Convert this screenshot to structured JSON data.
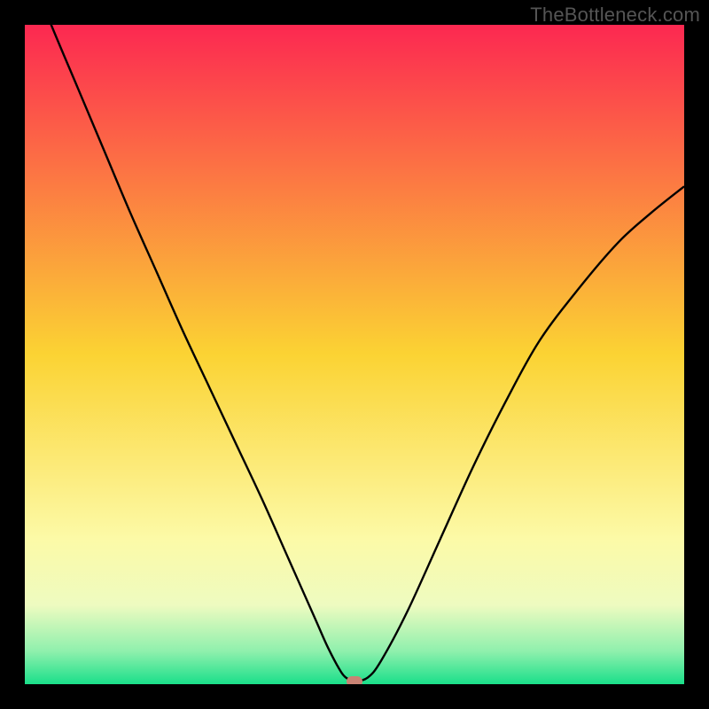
{
  "watermark": "TheBottleneck.com",
  "chart_data": {
    "type": "line",
    "title": "",
    "xlabel": "",
    "ylabel": "",
    "xlim": [
      0,
      100
    ],
    "ylim": [
      0,
      100
    ],
    "grid": false,
    "legend": false,
    "background_gradient": {
      "stops": [
        {
          "pos": 0.0,
          "color": "#fc2851"
        },
        {
          "pos": 0.5,
          "color": "#fbd333"
        },
        {
          "pos": 0.78,
          "color": "#fcfaa7"
        },
        {
          "pos": 0.88,
          "color": "#eefbc0"
        },
        {
          "pos": 0.95,
          "color": "#8ff0ad"
        },
        {
          "pos": 1.0,
          "color": "#1adf8a"
        }
      ]
    },
    "series": [
      {
        "name": "bottleneck-curve",
        "color": "#000000",
        "x": [
          0,
          4,
          8,
          12,
          16,
          20,
          24,
          28,
          32,
          36,
          40,
          44,
          46,
          48,
          49,
          50,
          52,
          54,
          58,
          63,
          68,
          73,
          78,
          84,
          90,
          95,
          100
        ],
        "y": [
          110,
          100,
          90.5,
          81,
          71.5,
          62.5,
          53.5,
          45,
          36.5,
          28,
          19,
          10,
          5.5,
          1.8,
          0.8,
          0.4,
          1.0,
          3.5,
          11,
          22,
          33,
          43,
          52,
          60,
          67,
          71.5,
          75.5
        ]
      }
    ],
    "marker": {
      "x": 50,
      "y": 0.4,
      "color": "#c98374"
    }
  }
}
